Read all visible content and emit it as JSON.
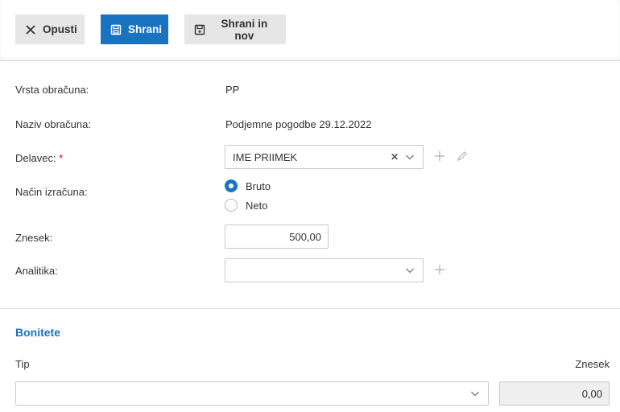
{
  "toolbar": {
    "cancel_label": "Opusti",
    "save_label": "Shrani",
    "save_new_label": "Shrani in nov"
  },
  "form": {
    "calc_type": {
      "label": "Vrsta obračuna:",
      "value": "PP"
    },
    "calc_name": {
      "label": "Naziv obračuna:",
      "value": "Podjemne pogodbe 29.12.2022"
    },
    "worker": {
      "label": "Delavec:",
      "required_mark": "*",
      "value": "IME PRIIMEK"
    },
    "method": {
      "label": "Način izračuna:",
      "options": [
        "Bruto",
        "Neto"
      ],
      "selected": "Bruto"
    },
    "amount": {
      "label": "Znesek:",
      "value": "500,00"
    },
    "analytics": {
      "label": "Analitika:",
      "value": ""
    }
  },
  "bonitete": {
    "title": "Bonitete",
    "col_type": "Tip",
    "col_amount": "Znesek",
    "row": {
      "type": "",
      "amount": "0,00"
    }
  },
  "colors": {
    "accent": "#1a73c0",
    "required": "#d0021b"
  },
  "icons": {
    "cancel": "close-icon",
    "save": "floppy-disk-icon",
    "save_new": "floppy-disk-plus-icon",
    "add": "plus-icon",
    "edit": "pencil-icon",
    "dropdown": "chevron-down-icon",
    "clear": "clear-x-icon"
  }
}
